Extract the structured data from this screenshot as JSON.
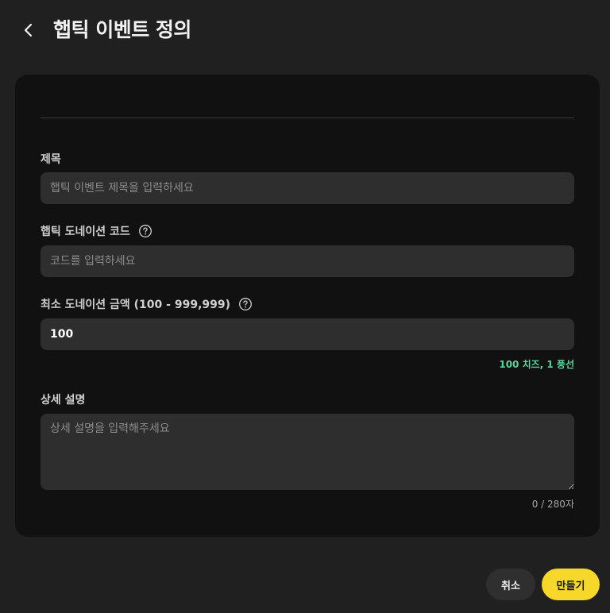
{
  "header": {
    "title": "햅틱 이벤트 정의",
    "back_icon": "chevron-left-icon"
  },
  "form": {
    "title_label": "제목",
    "title_placeholder": "햅틱 이벤트 제목을 입력하세요",
    "title_value": "",
    "code_label": "햅틱 도네이션 코드",
    "code_placeholder": "코드를 입력하세요",
    "code_value": "",
    "amount_label": "최소 도네이션 금액 (100 - 999,999)",
    "amount_value": "100",
    "amount_helper": "100 치즈, 1 풍선",
    "description_label": "상세 설명",
    "description_placeholder": "상세 설명을 입력해주세요",
    "description_counter": "0 / 280자",
    "help_icon": "question-circle-icon"
  },
  "actions": {
    "cancel_label": "취소",
    "create_label": "만들기"
  },
  "colors": {
    "background": "#202020",
    "card": "#111111",
    "field": "#2e2e2e",
    "accent": "#f7d72a",
    "helper_green": "#5fd19a"
  }
}
